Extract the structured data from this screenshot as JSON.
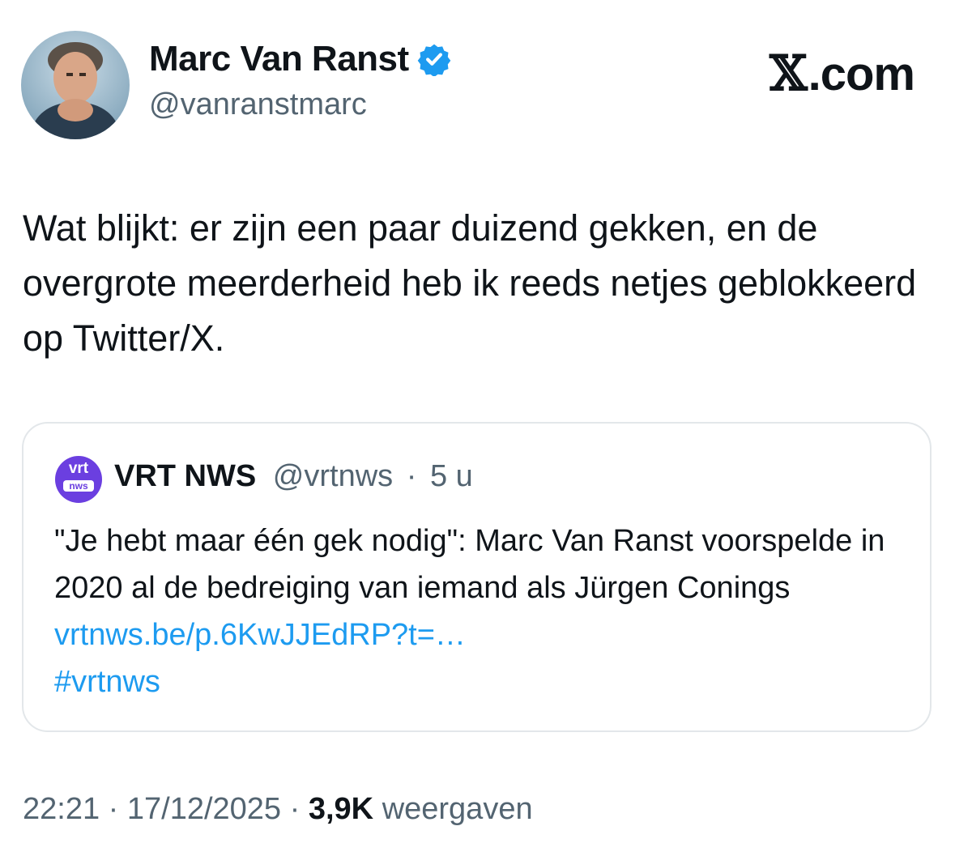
{
  "author": {
    "display_name": "Marc Van Ranst",
    "handle": "@vanranstmarc",
    "verified_icon": "verified-badge-icon",
    "verified_color": "#1d9bf0"
  },
  "brand": {
    "label": ".com",
    "logo_icon": "x-logo-icon"
  },
  "tweet": {
    "text": "Wat blijkt: er zijn een paar duizend gekken, en de overgrote meerderheid heb ik reeds netjes geblokkeerd op Twitter/X."
  },
  "quote": {
    "logo_line1": "vrt",
    "logo_line2": "nws",
    "name": "VRT NWS",
    "handle": "@vrtnws",
    "separator": "·",
    "time": "5 u",
    "text": "\"Je hebt maar één gek nodig\": Marc Van Ranst voorspelde in 2020 al de bedreiging van iemand als Jürgen Conings",
    "link": "vrtnws.be/p.6KwJJEdRP?t=…",
    "hashtag": "#vrtnws",
    "logo_color": "#6b3fe0",
    "link_color": "#1d9bf0"
  },
  "meta": {
    "time": "22:21",
    "sep1": "·",
    "date": "17/12/2025",
    "sep2": "·",
    "views_count": "3,9K",
    "views_label": "weergaven"
  }
}
